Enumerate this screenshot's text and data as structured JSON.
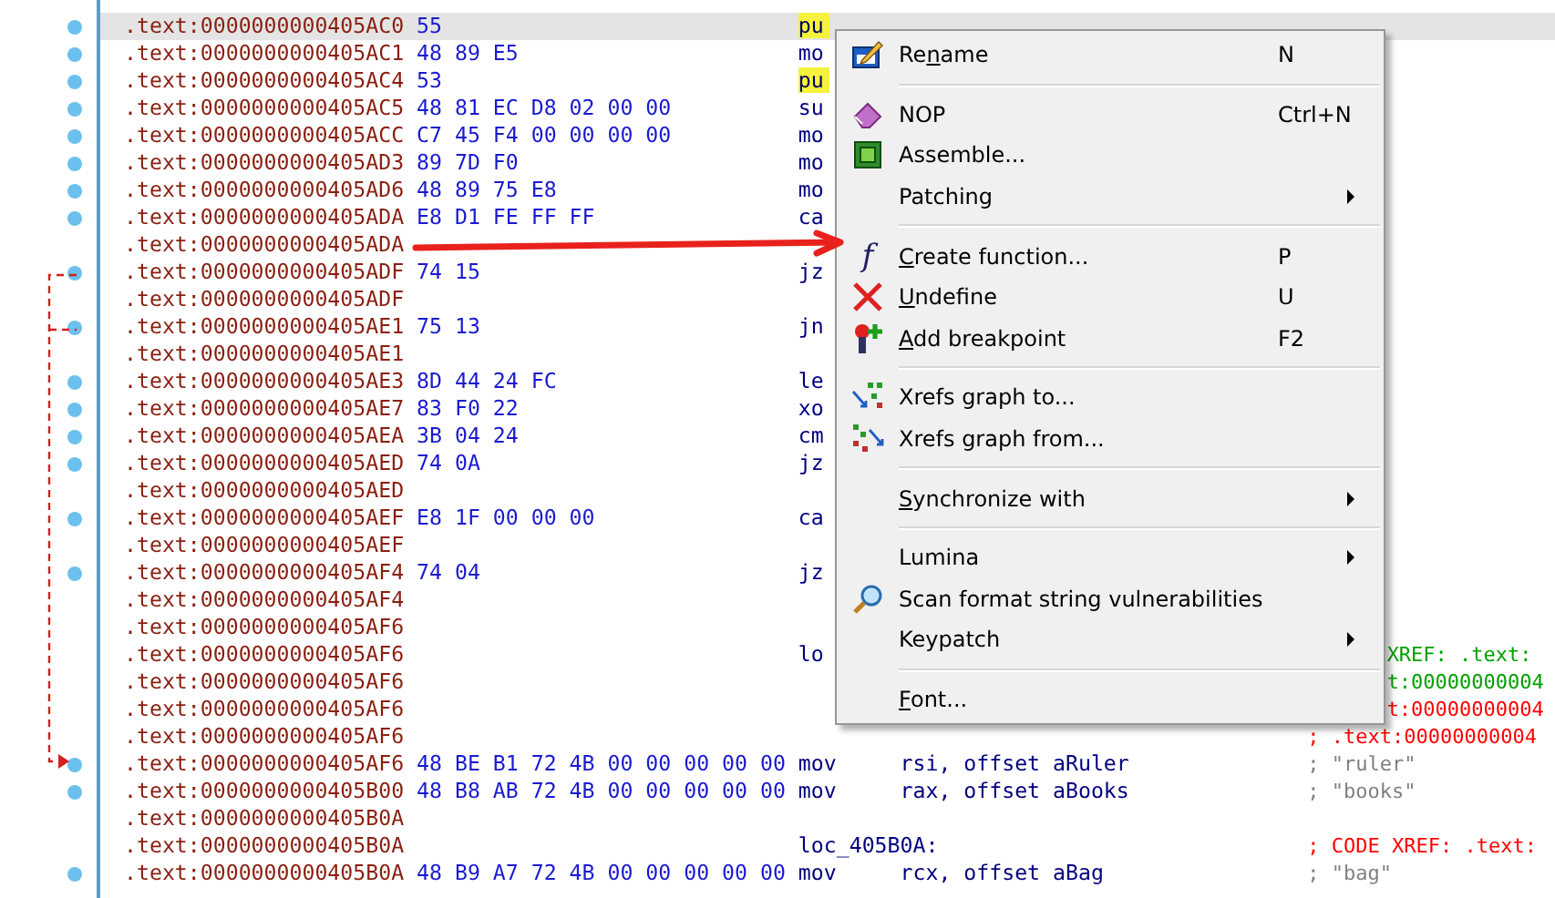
{
  "listing": {
    "rows": [
      {
        "address": ".text:0000000000405AC0",
        "bytes": "55",
        "mnemonic": "pu",
        "highlighted": true,
        "selected": true
      },
      {
        "address": ".text:0000000000405AC1",
        "bytes": "48 89 E5",
        "mnemonic": "mo",
        "highlighted": false,
        "selected": false
      },
      {
        "address": ".text:0000000000405AC4",
        "bytes": "53",
        "mnemonic": "pu",
        "highlighted": true,
        "selected": false
      },
      {
        "address": ".text:0000000000405AC5",
        "bytes": "48 81 EC D8 02 00 00",
        "mnemonic": "su",
        "highlighted": false,
        "selected": false
      },
      {
        "address": ".text:0000000000405ACC",
        "bytes": "C7 45 F4 00 00 00 00",
        "mnemonic": "mo",
        "highlighted": false,
        "selected": false
      },
      {
        "address": ".text:0000000000405AD3",
        "bytes": "89 7D F0",
        "mnemonic": "mo",
        "highlighted": false,
        "selected": false
      },
      {
        "address": ".text:0000000000405AD6",
        "bytes": "48 89 75 E8",
        "mnemonic": "mo",
        "highlighted": false,
        "selected": false
      },
      {
        "address": ".text:0000000000405ADA",
        "bytes": "E8 D1 FE FF FF",
        "mnemonic": "ca",
        "highlighted": false,
        "selected": false
      },
      {
        "address": ".text:0000000000405ADA",
        "selected": false
      },
      {
        "address": ".text:0000000000405ADF",
        "bytes": "74 15",
        "mnemonic": "jz",
        "highlighted": false,
        "selected": false
      },
      {
        "address": ".text:0000000000405ADF",
        "selected": false
      },
      {
        "address": ".text:0000000000405AE1",
        "bytes": "75 13",
        "mnemonic": "jn",
        "highlighted": false,
        "selected": false
      },
      {
        "address": ".text:0000000000405AE1",
        "selected": false
      },
      {
        "address": ".text:0000000000405AE3",
        "bytes": "8D 44 24 FC",
        "mnemonic": "le",
        "highlighted": false,
        "selected": false
      },
      {
        "address": ".text:0000000000405AE7",
        "bytes": "83 F0 22",
        "mnemonic": "xo",
        "highlighted": false,
        "selected": false
      },
      {
        "address": ".text:0000000000405AEA",
        "bytes": "3B 04 24",
        "mnemonic": "cm",
        "highlighted": false,
        "selected": false
      },
      {
        "address": ".text:0000000000405AED",
        "bytes": "74 0A",
        "mnemonic": "jz",
        "highlighted": false,
        "selected": false
      },
      {
        "address": ".text:0000000000405AED",
        "selected": false
      },
      {
        "address": ".text:0000000000405AEF",
        "bytes": "E8 1F 00 00 00",
        "mnemonic": "ca",
        "highlighted": false,
        "selected": false
      },
      {
        "address": ".text:0000000000405AEF",
        "selected": false
      },
      {
        "address": ".text:0000000000405AF4",
        "bytes": "74 04",
        "mnemonic": "jz",
        "highlighted": false,
        "selected": false
      },
      {
        "address": ".text:0000000000405AF4",
        "selected": false
      },
      {
        "address": ".text:0000000000405AF6",
        "selected": false
      },
      {
        "address": ".text:0000000000405AF6",
        "mnemonic": "lo",
        "highlighted": false,
        "selected": false,
        "comment": {
          "text": "XREF: .text:",
          "color": "#00a000",
          "kind": "continued"
        }
      },
      {
        "address": ".text:0000000000405AF6",
        "selected": false,
        "comment": {
          "text": "t:00000000004",
          "color": "#00a000",
          "kind": "continued"
        }
      },
      {
        "address": ".text:0000000000405AF6",
        "selected": false,
        "comment": {
          "text": "t:00000000004",
          "color": "#ff0000",
          "kind": "continued"
        }
      },
      {
        "address": ".text:0000000000405AF6",
        "selected": false,
        "comment": {
          "text": "; .text:00000000004",
          "color": "#ff0000",
          "kind": "full"
        }
      },
      {
        "address": ".text:0000000000405AF6",
        "bytes": "48 BE B1 72 4B 00 00 00 00 00",
        "mnemonic": "mov",
        "operands": "rsi, offset aRuler",
        "highlighted": false,
        "selected": false,
        "comment": {
          "text": "; \"ruler\"",
          "color": "#808080",
          "kind": "full"
        }
      },
      {
        "address": ".text:0000000000405B00",
        "bytes": "48 B8 AB 72 4B 00 00 00 00 00",
        "mnemonic": "mov",
        "operands": "rax, offset aBooks",
        "highlighted": false,
        "selected": false,
        "comment": {
          "text": "; \"books\"",
          "color": "#808080",
          "kind": "full"
        }
      },
      {
        "address": ".text:0000000000405B0A",
        "selected": false
      },
      {
        "address": ".text:0000000000405B0A",
        "mnemonic": "loc_405B0A:",
        "highlighted": false,
        "selected": false,
        "comment": {
          "text": "; CODE XREF: .text:",
          "color": "#ff0000",
          "kind": "full"
        }
      },
      {
        "address": ".text:0000000000405B0A",
        "bytes": "48 B9 A7 72 4B 00 00 00 00 00",
        "mnemonic": "mov",
        "operands": "rcx, offset aBag",
        "highlighted": false,
        "selected": false,
        "comment": {
          "text": "; \"bag\"",
          "color": "#808080",
          "kind": "full"
        }
      }
    ]
  },
  "context_menu": {
    "groups": [
      [
        {
          "label_before": "Re",
          "access_key": "n",
          "label_after": "ame",
          "shortcut": "N",
          "kind": "pencil"
        }
      ],
      [
        {
          "label": "NOP",
          "shortcut": "Ctrl+N",
          "kind": "eraser"
        },
        {
          "label": "Assemble...",
          "kind": "chip"
        },
        {
          "label": "Patching",
          "submenu": true
        }
      ],
      [
        {
          "access_key": "C",
          "label_after": "reate function...",
          "shortcut": "P",
          "kind": "function",
          "icon_text": "f"
        },
        {
          "access_key": "U",
          "label_after": "ndefine",
          "shortcut": "U",
          "kind": "cross"
        },
        {
          "access_key": "A",
          "label_after": "dd breakpoint",
          "shortcut": "F2",
          "kind": "breakpoint"
        }
      ],
      [
        {
          "label": "Xrefs graph to...",
          "kind": "graph-to"
        },
        {
          "label": "Xrefs graph from...",
          "kind": "graph-from"
        }
      ],
      [
        {
          "access_key": "S",
          "label_after": "ynchronize with",
          "submenu": true
        }
      ],
      [
        {
          "label": "Lumina",
          "submenu": true
        },
        {
          "label": "Scan format string vulnerabilities",
          "kind": "magnifier"
        },
        {
          "label": "Keypatch",
          "submenu": true
        }
      ],
      [
        {
          "access_key": "F",
          "label_after": "ont..."
        }
      ]
    ]
  }
}
